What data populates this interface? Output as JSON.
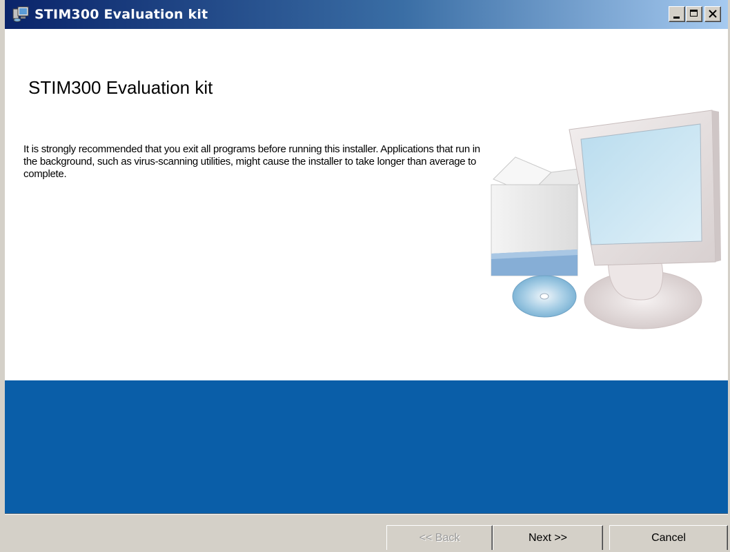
{
  "window": {
    "title": "STIM300 Evaluation kit"
  },
  "content": {
    "heading": "STIM300 Evaluation kit",
    "description": "It is strongly recommended that you exit all programs before running this installer. Applications that run in the background, such as virus-scanning utilities, might cause the installer to take longer than average to complete."
  },
  "buttons": {
    "back": "<< Back",
    "next": "Next >>",
    "cancel": "Cancel"
  },
  "icons": {
    "app": "installer-computer-icon",
    "illustration": "computer-setup-illustration"
  },
  "colors": {
    "titlebar_start": "#0a246a",
    "titlebar_end": "#a6caf0",
    "band": "#0a5ea8",
    "chrome": "#d4d0c8"
  }
}
